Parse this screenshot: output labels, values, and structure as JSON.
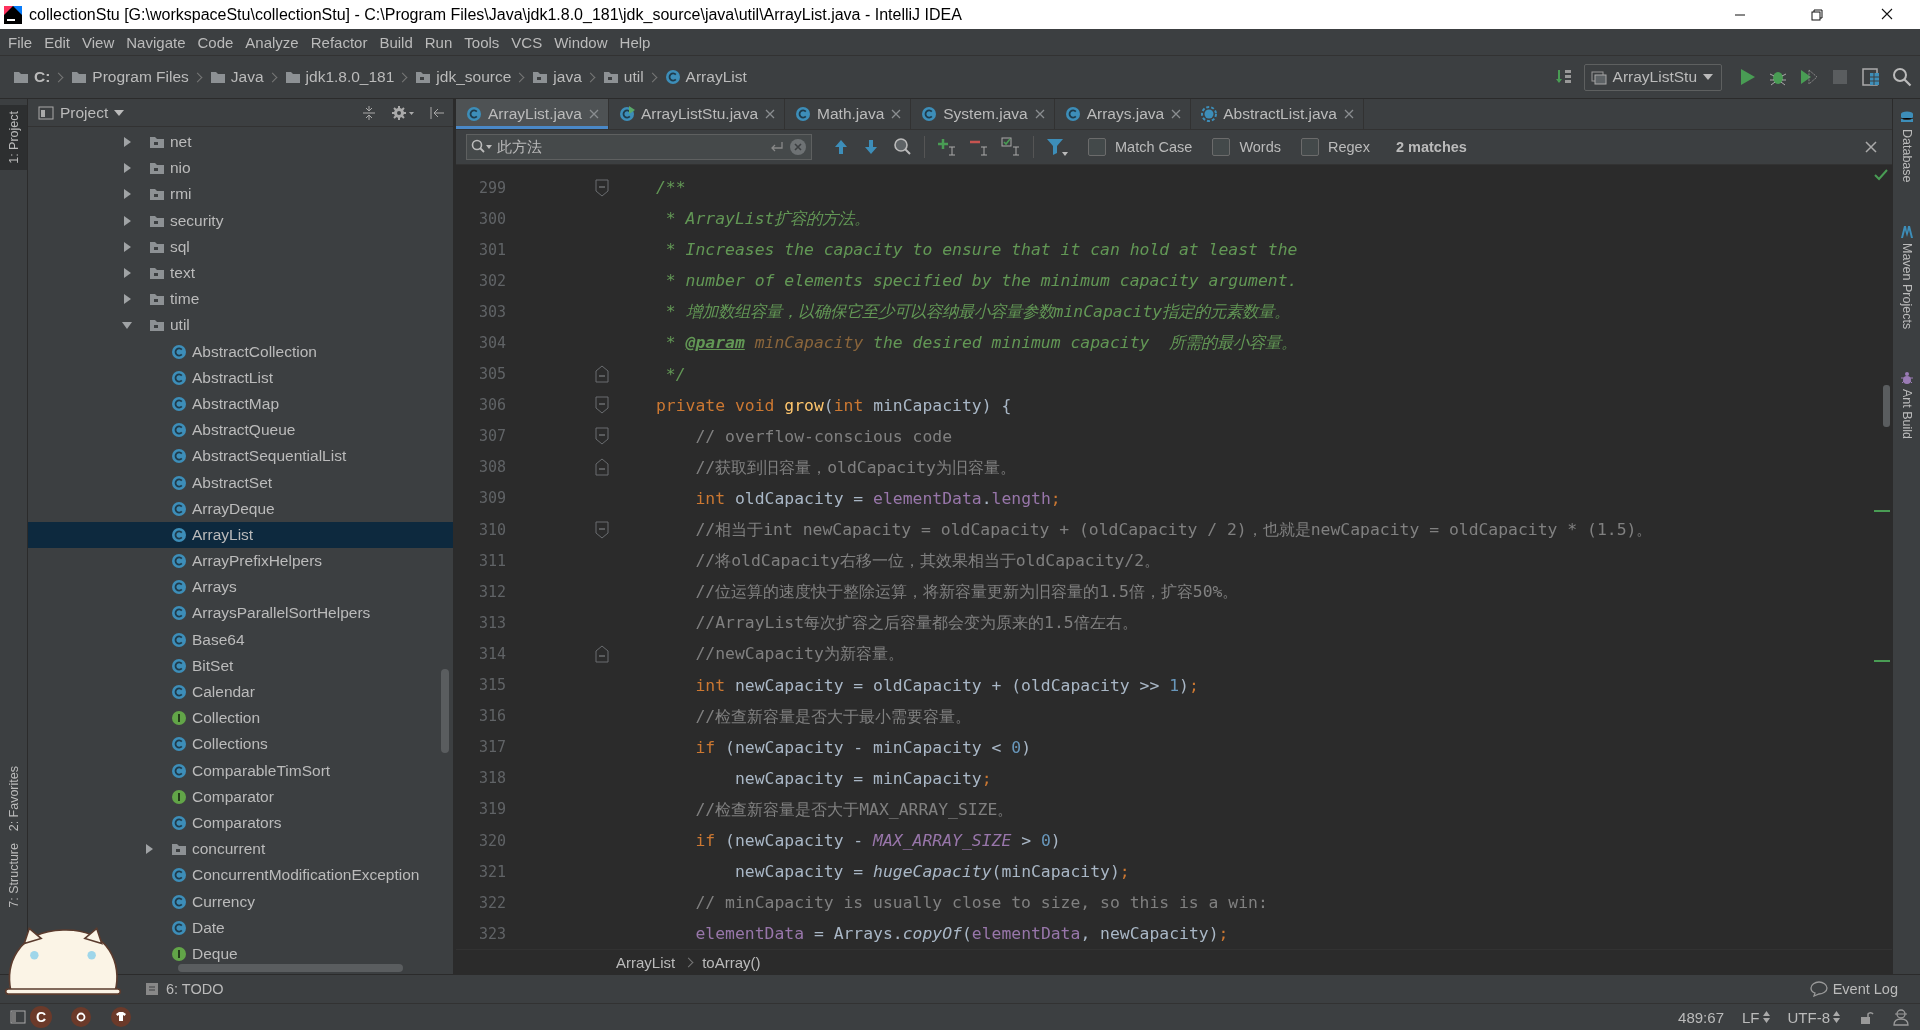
{
  "window": {
    "title": "collectionStu [G:\\workspaceStu\\collectionStu] - C:\\Program Files\\Java\\jdk1.8.0_181\\jdk_source\\java\\util\\ArrayList.java - IntelliJ IDEA"
  },
  "menu": [
    "File",
    "Edit",
    "View",
    "Navigate",
    "Code",
    "Analyze",
    "Refactor",
    "Build",
    "Run",
    "Tools",
    "VCS",
    "Window",
    "Help"
  ],
  "nav_path": [
    {
      "label": "C:",
      "kind": "drive"
    },
    {
      "label": "Program Files",
      "kind": "folder"
    },
    {
      "label": "Java",
      "kind": "folder"
    },
    {
      "label": "jdk1.8.0_181",
      "kind": "folder"
    },
    {
      "label": "jdk_source",
      "kind": "package"
    },
    {
      "label": "java",
      "kind": "package"
    },
    {
      "label": "util",
      "kind": "package"
    },
    {
      "label": "ArrayList",
      "kind": "class"
    }
  ],
  "run_config": "ArrayListStu",
  "left_stripe": [
    {
      "label": "1: Project",
      "selected": true
    },
    {
      "label": "2: Favorites",
      "selected": false
    },
    {
      "label": "7: Structure",
      "selected": false
    }
  ],
  "right_stripe": [
    "Database",
    "Maven Projects",
    "Ant Build"
  ],
  "project_panel": {
    "title": "Project",
    "tree": [
      {
        "label": "net",
        "kind": "package",
        "expanded": false,
        "selected": false
      },
      {
        "label": "nio",
        "kind": "package",
        "expanded": false,
        "selected": false
      },
      {
        "label": "rmi",
        "kind": "package",
        "expanded": false,
        "selected": false
      },
      {
        "label": "security",
        "kind": "package",
        "expanded": false,
        "selected": false
      },
      {
        "label": "sql",
        "kind": "package",
        "expanded": false,
        "selected": false
      },
      {
        "label": "text",
        "kind": "package",
        "expanded": false,
        "selected": false
      },
      {
        "label": "time",
        "kind": "package",
        "expanded": false,
        "selected": false
      },
      {
        "label": "util",
        "kind": "package",
        "expanded": true,
        "selected": false,
        "children": [
          {
            "label": "AbstractCollection",
            "kind": "class",
            "selected": false
          },
          {
            "label": "AbstractList",
            "kind": "class",
            "selected": false
          },
          {
            "label": "AbstractMap",
            "kind": "class",
            "selected": false
          },
          {
            "label": "AbstractQueue",
            "kind": "class",
            "selected": false
          },
          {
            "label": "AbstractSequentialList",
            "kind": "class",
            "selected": false
          },
          {
            "label": "AbstractSet",
            "kind": "class",
            "selected": false
          },
          {
            "label": "ArrayDeque",
            "kind": "class",
            "selected": false
          },
          {
            "label": "ArrayList",
            "kind": "class",
            "selected": true
          },
          {
            "label": "ArrayPrefixHelpers",
            "kind": "class",
            "selected": false
          },
          {
            "label": "Arrays",
            "kind": "class",
            "selected": false
          },
          {
            "label": "ArraysParallelSortHelpers",
            "kind": "class",
            "selected": false
          },
          {
            "label": "Base64",
            "kind": "class",
            "selected": false
          },
          {
            "label": "BitSet",
            "kind": "class",
            "selected": false
          },
          {
            "label": "Calendar",
            "kind": "class",
            "selected": false
          },
          {
            "label": "Collection",
            "kind": "interface",
            "selected": false
          },
          {
            "label": "Collections",
            "kind": "class",
            "selected": false
          },
          {
            "label": "ComparableTimSort",
            "kind": "class",
            "selected": false
          },
          {
            "label": "Comparator",
            "kind": "interface",
            "selected": false
          },
          {
            "label": "Comparators",
            "kind": "class",
            "selected": false
          },
          {
            "label": "concurrent",
            "kind": "package",
            "expanded": false,
            "selected": false
          },
          {
            "label": "ConcurrentModificationException",
            "kind": "class",
            "selected": false
          },
          {
            "label": "Currency",
            "kind": "class",
            "selected": false
          },
          {
            "label": "Date",
            "kind": "class",
            "selected": false
          },
          {
            "label": "Deque",
            "kind": "interface",
            "selected": false
          }
        ]
      }
    ]
  },
  "tabs": [
    {
      "label": "ArrayList.java",
      "kind": "class",
      "selected": true
    },
    {
      "label": "ArrayListStu.java",
      "kind": "runnable",
      "selected": false
    },
    {
      "label": "Math.java",
      "kind": "class",
      "selected": false
    },
    {
      "label": "System.java",
      "kind": "class",
      "selected": false
    },
    {
      "label": "Arrays.java",
      "kind": "class",
      "selected": false
    },
    {
      "label": "AbstractList.java",
      "kind": "abstract",
      "selected": false
    }
  ],
  "search": {
    "value": "此方法",
    "options": [
      {
        "label": "Match Case",
        "checked": false
      },
      {
        "label": "Words",
        "checked": false
      },
      {
        "label": "Regex",
        "checked": false
      }
    ],
    "result": "2 matches"
  },
  "code": [
    {
      "num": "299",
      "fold_start": true,
      "tokens": [
        {
          "kind": "doc",
          "text": "/**"
        }
      ]
    },
    {
      "num": "300",
      "tokens": [
        {
          "kind": "doc",
          "text": " * ArrayList扩容的方法。"
        }
      ]
    },
    {
      "num": "301",
      "tokens": [
        {
          "kind": "doc",
          "text": " * Increases the capacity to ensure that it can hold at least the"
        }
      ]
    },
    {
      "num": "302",
      "tokens": [
        {
          "kind": "doc",
          "text": " * number of elements specified by the minimum capacity argument."
        }
      ]
    },
    {
      "num": "303",
      "tokens": [
        {
          "kind": "doc",
          "text": " * 增加数组容量，以确保它至少可以容纳最小容量参数minCapacity指定的元素数量。"
        }
      ]
    },
    {
      "num": "304",
      "tokens": [
        {
          "kind": "doc",
          "text": " * "
        },
        {
          "kind": "doctag",
          "text": "@param"
        },
        {
          "kind": "docparam",
          "text": " minCapacity"
        },
        {
          "kind": "doc",
          "text": " the desired minimum capacity  所需的最小容量。"
        }
      ]
    },
    {
      "num": "305",
      "fold_end": true,
      "tokens": [
        {
          "kind": "doc",
          "text": " */"
        }
      ]
    },
    {
      "num": "306",
      "fold_start": true,
      "tokens": [
        {
          "kind": "kw",
          "text": "private void "
        },
        {
          "kind": "decl",
          "text": "grow"
        },
        {
          "kind": "text",
          "text": "("
        },
        {
          "kind": "kw",
          "text": "int"
        },
        {
          "kind": "text",
          "text": " minCapacity) {"
        }
      ]
    },
    {
      "num": "307",
      "fold_start": true,
      "tokens": [
        {
          "kind": "comment",
          "text": "    // overflow-conscious code"
        }
      ]
    },
    {
      "num": "308",
      "fold_end": true,
      "tokens": [
        {
          "kind": "comment",
          "text": "    //获取到旧容量，oldCapacity为旧容量。"
        }
      ]
    },
    {
      "num": "309",
      "tokens": [
        {
          "kind": "kw",
          "text": "    int"
        },
        {
          "kind": "text",
          "text": " oldCapacity = "
        },
        {
          "kind": "field",
          "text": "elementData"
        },
        {
          "kind": "text",
          "text": "."
        },
        {
          "kind": "field",
          "text": "length"
        },
        {
          "kind": "kw",
          "text": ";"
        }
      ]
    },
    {
      "num": "310",
      "fold_start": true,
      "tokens": [
        {
          "kind": "comment",
          "text": "    //相当于int newCapacity = oldCapacity + (oldCapacity / 2)，也就是newCapacity = oldCapacity * (1.5)。"
        }
      ]
    },
    {
      "num": "311",
      "tokens": [
        {
          "kind": "comment",
          "text": "    //将oldCapacity右移一位，其效果相当于oldCapacity/2。"
        }
      ]
    },
    {
      "num": "312",
      "tokens": [
        {
          "kind": "comment",
          "text": "    //位运算的速度快于整除运算，将新容量更新为旧容量的1.5倍，扩容50%。"
        }
      ]
    },
    {
      "num": "313",
      "tokens": [
        {
          "kind": "comment",
          "text": "    //ArrayList每次扩容之后容量都会变为原来的1.5倍左右。"
        }
      ]
    },
    {
      "num": "314",
      "fold_end": true,
      "tokens": [
        {
          "kind": "comment",
          "text": "    //newCapacity为新容量。"
        }
      ]
    },
    {
      "num": "315",
      "tokens": [
        {
          "kind": "kw",
          "text": "    int"
        },
        {
          "kind": "text",
          "text": " newCapacity = oldCapacity + (oldCapacity >> "
        },
        {
          "kind": "num",
          "text": "1"
        },
        {
          "kind": "text",
          "text": ")"
        },
        {
          "kind": "kw",
          "text": ";"
        }
      ]
    },
    {
      "num": "316",
      "tokens": [
        {
          "kind": "comment",
          "text": "    //检查新容量是否大于最小需要容量。"
        }
      ]
    },
    {
      "num": "317",
      "tokens": [
        {
          "kind": "kw",
          "text": "    if"
        },
        {
          "kind": "text",
          "text": " (newCapacity - minCapacity < "
        },
        {
          "kind": "num",
          "text": "0"
        },
        {
          "kind": "text",
          "text": ")"
        }
      ]
    },
    {
      "num": "318",
      "tokens": [
        {
          "kind": "text",
          "text": "        newCapacity = minCapacity"
        },
        {
          "kind": "kw",
          "text": ";"
        }
      ]
    },
    {
      "num": "319",
      "tokens": [
        {
          "kind": "comment",
          "text": "    //检查新容量是否大于MAX_ARRAY_SIZE。"
        }
      ]
    },
    {
      "num": "320",
      "tokens": [
        {
          "kind": "kw",
          "text": "    if"
        },
        {
          "kind": "text",
          "text": " (newCapacity - "
        },
        {
          "kind": "const",
          "text": "MAX_ARRAY_SIZE"
        },
        {
          "kind": "text",
          "text": " > "
        },
        {
          "kind": "num",
          "text": "0"
        },
        {
          "kind": "text",
          "text": ")"
        }
      ]
    },
    {
      "num": "321",
      "tokens": [
        {
          "kind": "text",
          "text": "        newCapacity = "
        },
        {
          "kind": "static",
          "text": "hugeCapacity"
        },
        {
          "kind": "text",
          "text": "(minCapacity)"
        },
        {
          "kind": "kw",
          "text": ";"
        }
      ]
    },
    {
      "num": "322",
      "tokens": [
        {
          "kind": "comment",
          "text": "    // minCapacity is usually close to size, so this is a win:"
        }
      ]
    },
    {
      "num": "323",
      "tokens": [
        {
          "kind": "field",
          "text": "    elementData"
        },
        {
          "kind": "text",
          "text": " = Arrays."
        },
        {
          "kind": "static",
          "text": "copyOf"
        },
        {
          "kind": "text",
          "text": "("
        },
        {
          "kind": "field",
          "text": "elementData"
        },
        {
          "kind": "text",
          "text": ", newCapacity)"
        },
        {
          "kind": "kw",
          "text": ";"
        }
      ]
    }
  ],
  "breadcrumbs": [
    "ArrayList",
    "toArray()"
  ],
  "tool_bar": {
    "todo": "6: TODO",
    "event_log": "Event Log"
  },
  "status_bar": {
    "badge": "C",
    "position": "489:67",
    "line_separator": "LF",
    "encoding": "UTF-8"
  }
}
